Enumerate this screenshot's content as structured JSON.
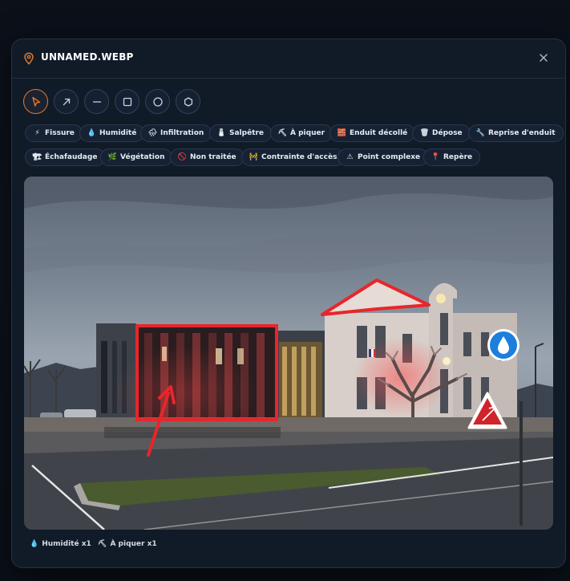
{
  "dialog": {
    "title": "UNNAMED.WEBP"
  },
  "tools": [
    {
      "name": "select",
      "icon": "cursor-icon",
      "active": true
    },
    {
      "name": "arrow",
      "icon": "arrow-icon"
    },
    {
      "name": "line",
      "icon": "line-icon"
    },
    {
      "name": "rectangle",
      "icon": "square-icon"
    },
    {
      "name": "circle",
      "icon": "circle-icon"
    },
    {
      "name": "polygon",
      "icon": "hexagon-icon"
    }
  ],
  "tags_row1": [
    {
      "label": "Fissure",
      "icon": "⚡",
      "icon_name": "lightning-icon"
    },
    {
      "label": "Humidité",
      "icon": "💧",
      "icon_name": "droplet-icon"
    },
    {
      "label": "Infiltration",
      "icon": "🌧",
      "icon_name": "rain-cloud-icon"
    },
    {
      "label": "Salpêtre",
      "icon": "🧂",
      "icon_name": "salt-icon"
    },
    {
      "label": "À piquer",
      "icon": "⛏",
      "icon_name": "pickaxe-icon"
    },
    {
      "label": "Enduit décollé",
      "icon": "🧱",
      "icon_name": "brick-icon"
    },
    {
      "label": "Dépose",
      "icon": "🗑",
      "icon_name": "trash-icon"
    },
    {
      "label": "Reprise d'enduit",
      "icon": "🔧",
      "icon_name": "wrench-icon"
    }
  ],
  "tags_row2": [
    {
      "label": "Échafaudage",
      "icon": "🏗",
      "icon_name": "scaffold-icon"
    },
    {
      "label": "Végétation",
      "icon": "🌿",
      "icon_name": "leaf-icon"
    },
    {
      "label": "Non traitée",
      "icon": "🚫",
      "icon_name": "prohibited-icon"
    },
    {
      "label": "Contrainte d'accès",
      "icon": "🚧",
      "icon_name": "barrier-icon"
    },
    {
      "label": "Point complexe",
      "icon": "⚠",
      "icon_name": "warning-icon"
    },
    {
      "label": "Repère",
      "icon": "📍",
      "icon_name": "pin-icon"
    }
  ],
  "footer": {
    "counts": [
      {
        "label": "Humidité x1",
        "icon": "💧",
        "icon_name": "droplet-icon"
      },
      {
        "label": "À piquer x1",
        "icon": "⛏",
        "icon_name": "pickaxe-icon"
      }
    ]
  },
  "colors": {
    "accent": "#e07a2e",
    "annotation": "#e8262b",
    "marker_blue": "#1c7fdc"
  }
}
